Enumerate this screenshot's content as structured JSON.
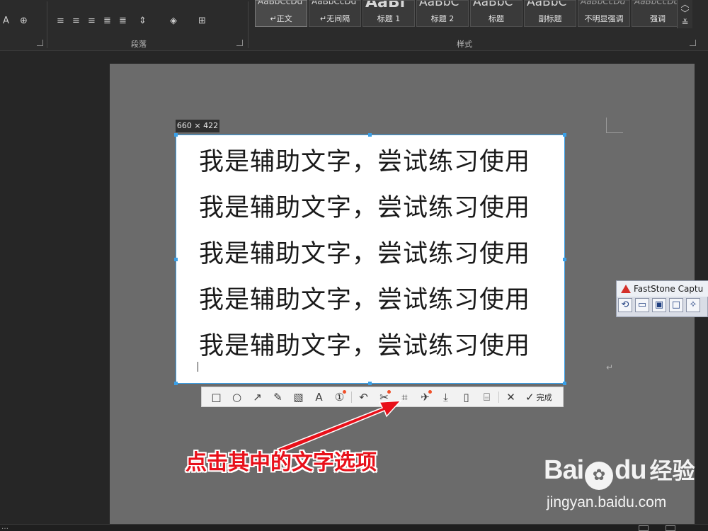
{
  "ribbon": {
    "paragraph_group_label": "段落",
    "styles_group_label": "样式",
    "styles": [
      {
        "sample": "AaBbCcDd",
        "name": "正文",
        "prefix": "↵",
        "size": "small",
        "italic": false,
        "active": true
      },
      {
        "sample": "AaBbCcDd",
        "name": "无间隔",
        "prefix": "↵",
        "size": "small",
        "italic": false,
        "active": false
      },
      {
        "sample": "AaBl",
        "name": "标题 1",
        "prefix": "",
        "size": "big",
        "italic": false,
        "active": false
      },
      {
        "sample": "AaBbC",
        "name": "标题 2",
        "prefix": "",
        "size": "mid",
        "italic": false,
        "active": false
      },
      {
        "sample": "AaBbC",
        "name": "标题",
        "prefix": "",
        "size": "mid",
        "italic": false,
        "active": false
      },
      {
        "sample": "AaBbC",
        "name": "副标题",
        "prefix": "",
        "size": "mid",
        "italic": false,
        "active": false
      },
      {
        "sample": "AaBbCcDd",
        "name": "不明显强调",
        "prefix": "",
        "size": "small",
        "italic": true,
        "active": false
      },
      {
        "sample": "AaBbCcDd",
        "name": "强调",
        "prefix": "",
        "size": "small",
        "italic": true,
        "active": false
      }
    ]
  },
  "capture": {
    "dimensions_label": "660 × 422",
    "text_lines": [
      "我是辅助文字，尝试练习使用",
      "我是辅助文字，尝试练习使用",
      "我是辅助文字，尝试练习使用",
      "我是辅助文字，尝试练习使用",
      "我是辅助文字，尝试练习使用"
    ]
  },
  "toolbar": {
    "tools": [
      {
        "icon": "rectangle-icon",
        "glyph": "□",
        "dot": false
      },
      {
        "icon": "ellipse-icon",
        "glyph": "○",
        "dot": false
      },
      {
        "icon": "arrow-icon",
        "glyph": "↗",
        "dot": false
      },
      {
        "icon": "pencil-icon",
        "glyph": "✎",
        "dot": false
      },
      {
        "icon": "mosaic-icon",
        "glyph": "▧",
        "dot": false
      },
      {
        "icon": "text-icon",
        "glyph": "A",
        "dot": false
      },
      {
        "icon": "number-icon",
        "glyph": "①",
        "dot": true
      },
      {
        "sep": true
      },
      {
        "icon": "undo-icon",
        "glyph": "↶",
        "dot": false
      },
      {
        "icon": "cut-icon",
        "glyph": "✂",
        "dot": true
      },
      {
        "icon": "text-recognition-icon",
        "glyph": "⌗",
        "dot": false
      },
      {
        "icon": "pin-icon",
        "glyph": "✈",
        "dot": true
      },
      {
        "icon": "download-icon",
        "glyph": "⤓",
        "dot": false
      },
      {
        "icon": "phone-icon",
        "glyph": "▯",
        "dot": false
      },
      {
        "icon": "bookmark-icon",
        "glyph": "⌸",
        "dot": false
      },
      {
        "sep": true
      },
      {
        "icon": "close-icon",
        "glyph": "✕",
        "dot": false
      }
    ],
    "done_label": "完成"
  },
  "faststone": {
    "title": "FastStone Captu",
    "tools": [
      "⟲",
      "▭",
      "▣",
      "□",
      "✧"
    ]
  },
  "annotation": {
    "text": "点击其中的文字选项",
    "color": "#e8101a"
  },
  "watermark": {
    "logo_left": "Bai",
    "logo_right": "du",
    "brand_cn": "经验",
    "url": "jingyan.baidu.com"
  },
  "statusbar": {
    "text": "…"
  }
}
